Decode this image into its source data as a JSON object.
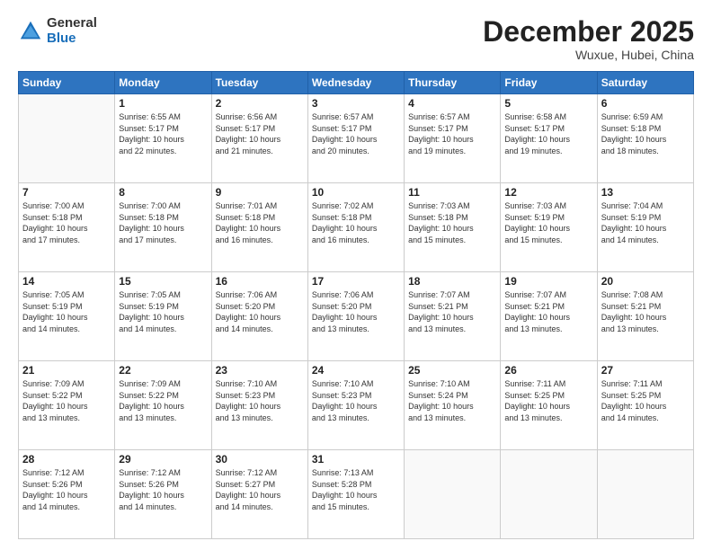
{
  "logo": {
    "general": "General",
    "blue": "Blue"
  },
  "header": {
    "month_title": "December 2025",
    "location": "Wuxue, Hubei, China"
  },
  "days_of_week": [
    "Sunday",
    "Monday",
    "Tuesday",
    "Wednesday",
    "Thursday",
    "Friday",
    "Saturday"
  ],
  "weeks": [
    [
      {
        "day": "",
        "info": ""
      },
      {
        "day": "1",
        "info": "Sunrise: 6:55 AM\nSunset: 5:17 PM\nDaylight: 10 hours\nand 22 minutes."
      },
      {
        "day": "2",
        "info": "Sunrise: 6:56 AM\nSunset: 5:17 PM\nDaylight: 10 hours\nand 21 minutes."
      },
      {
        "day": "3",
        "info": "Sunrise: 6:57 AM\nSunset: 5:17 PM\nDaylight: 10 hours\nand 20 minutes."
      },
      {
        "day": "4",
        "info": "Sunrise: 6:57 AM\nSunset: 5:17 PM\nDaylight: 10 hours\nand 19 minutes."
      },
      {
        "day": "5",
        "info": "Sunrise: 6:58 AM\nSunset: 5:17 PM\nDaylight: 10 hours\nand 19 minutes."
      },
      {
        "day": "6",
        "info": "Sunrise: 6:59 AM\nSunset: 5:18 PM\nDaylight: 10 hours\nand 18 minutes."
      }
    ],
    [
      {
        "day": "7",
        "info": "Sunrise: 7:00 AM\nSunset: 5:18 PM\nDaylight: 10 hours\nand 17 minutes."
      },
      {
        "day": "8",
        "info": "Sunrise: 7:00 AM\nSunset: 5:18 PM\nDaylight: 10 hours\nand 17 minutes."
      },
      {
        "day": "9",
        "info": "Sunrise: 7:01 AM\nSunset: 5:18 PM\nDaylight: 10 hours\nand 16 minutes."
      },
      {
        "day": "10",
        "info": "Sunrise: 7:02 AM\nSunset: 5:18 PM\nDaylight: 10 hours\nand 16 minutes."
      },
      {
        "day": "11",
        "info": "Sunrise: 7:03 AM\nSunset: 5:18 PM\nDaylight: 10 hours\nand 15 minutes."
      },
      {
        "day": "12",
        "info": "Sunrise: 7:03 AM\nSunset: 5:19 PM\nDaylight: 10 hours\nand 15 minutes."
      },
      {
        "day": "13",
        "info": "Sunrise: 7:04 AM\nSunset: 5:19 PM\nDaylight: 10 hours\nand 14 minutes."
      }
    ],
    [
      {
        "day": "14",
        "info": "Sunrise: 7:05 AM\nSunset: 5:19 PM\nDaylight: 10 hours\nand 14 minutes."
      },
      {
        "day": "15",
        "info": "Sunrise: 7:05 AM\nSunset: 5:19 PM\nDaylight: 10 hours\nand 14 minutes."
      },
      {
        "day": "16",
        "info": "Sunrise: 7:06 AM\nSunset: 5:20 PM\nDaylight: 10 hours\nand 14 minutes."
      },
      {
        "day": "17",
        "info": "Sunrise: 7:06 AM\nSunset: 5:20 PM\nDaylight: 10 hours\nand 13 minutes."
      },
      {
        "day": "18",
        "info": "Sunrise: 7:07 AM\nSunset: 5:21 PM\nDaylight: 10 hours\nand 13 minutes."
      },
      {
        "day": "19",
        "info": "Sunrise: 7:07 AM\nSunset: 5:21 PM\nDaylight: 10 hours\nand 13 minutes."
      },
      {
        "day": "20",
        "info": "Sunrise: 7:08 AM\nSunset: 5:21 PM\nDaylight: 10 hours\nand 13 minutes."
      }
    ],
    [
      {
        "day": "21",
        "info": "Sunrise: 7:09 AM\nSunset: 5:22 PM\nDaylight: 10 hours\nand 13 minutes."
      },
      {
        "day": "22",
        "info": "Sunrise: 7:09 AM\nSunset: 5:22 PM\nDaylight: 10 hours\nand 13 minutes."
      },
      {
        "day": "23",
        "info": "Sunrise: 7:10 AM\nSunset: 5:23 PM\nDaylight: 10 hours\nand 13 minutes."
      },
      {
        "day": "24",
        "info": "Sunrise: 7:10 AM\nSunset: 5:23 PM\nDaylight: 10 hours\nand 13 minutes."
      },
      {
        "day": "25",
        "info": "Sunrise: 7:10 AM\nSunset: 5:24 PM\nDaylight: 10 hours\nand 13 minutes."
      },
      {
        "day": "26",
        "info": "Sunrise: 7:11 AM\nSunset: 5:25 PM\nDaylight: 10 hours\nand 13 minutes."
      },
      {
        "day": "27",
        "info": "Sunrise: 7:11 AM\nSunset: 5:25 PM\nDaylight: 10 hours\nand 14 minutes."
      }
    ],
    [
      {
        "day": "28",
        "info": "Sunrise: 7:12 AM\nSunset: 5:26 PM\nDaylight: 10 hours\nand 14 minutes."
      },
      {
        "day": "29",
        "info": "Sunrise: 7:12 AM\nSunset: 5:26 PM\nDaylight: 10 hours\nand 14 minutes."
      },
      {
        "day": "30",
        "info": "Sunrise: 7:12 AM\nSunset: 5:27 PM\nDaylight: 10 hours\nand 14 minutes."
      },
      {
        "day": "31",
        "info": "Sunrise: 7:13 AM\nSunset: 5:28 PM\nDaylight: 10 hours\nand 15 minutes."
      },
      {
        "day": "",
        "info": ""
      },
      {
        "day": "",
        "info": ""
      },
      {
        "day": "",
        "info": ""
      }
    ]
  ]
}
